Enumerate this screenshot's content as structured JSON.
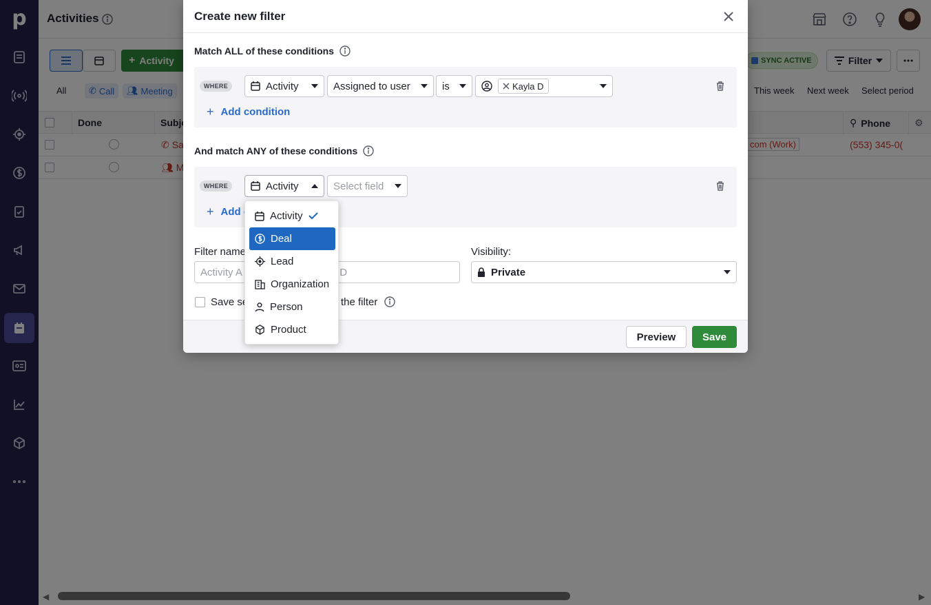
{
  "app": {
    "page_title": "Activities",
    "rail_logo": "p"
  },
  "toolbar": {
    "add_activity_label": "Activity",
    "sync_badge": "SYNC ACTIVE",
    "filter_label": "Filter"
  },
  "tabs": {
    "all": "All",
    "call": "Call",
    "meeting": "Meeting",
    "this_week": "This week",
    "next_week": "Next week",
    "select_period": "Select period"
  },
  "table": {
    "columns": {
      "done": "Done",
      "subject": "Subje",
      "phone": "Phone"
    },
    "rows": [
      {
        "subject": "Sa",
        "email": "com (Work)",
        "phone": "(553) 345-0("
      },
      {
        "subject": "M"
      }
    ]
  },
  "modal": {
    "title": "Create new filter",
    "match_all_title": "Match ALL of these conditions",
    "match_any_title": "And match ANY of these conditions",
    "where_label": "WHERE",
    "condition1": {
      "entity": "Activity",
      "field": "Assigned to user",
      "operator": "is",
      "value_chip": "Kayla D"
    },
    "condition2": {
      "entity": "Activity",
      "field_placeholder": "Select field"
    },
    "add_condition_label": "Add condition",
    "add_condition_partial": "Add c",
    "filter_name_label": "Filter name",
    "filter_name_value_left": "Activity A",
    "filter_name_value_right": "yla D",
    "visibility_label": "Visibility:",
    "visibility_value": "Private",
    "save_setting_left": "Save se",
    "save_setting_right": "the filter",
    "preview_label": "Preview",
    "save_label": "Save"
  },
  "dropdown": {
    "items": [
      {
        "label": "Activity",
        "icon": "calendar-icon",
        "selected": true
      },
      {
        "label": "Deal",
        "icon": "dollar-icon",
        "highlighted": true
      },
      {
        "label": "Lead",
        "icon": "target-icon"
      },
      {
        "label": "Organization",
        "icon": "building-icon"
      },
      {
        "label": "Person",
        "icon": "person-icon"
      },
      {
        "label": "Product",
        "icon": "box-icon"
      }
    ]
  },
  "colors": {
    "rail": "#24214a",
    "accent_blue": "#1f68c2",
    "primary_green": "#2f8a3a",
    "overdue_red": "#c8352a"
  }
}
